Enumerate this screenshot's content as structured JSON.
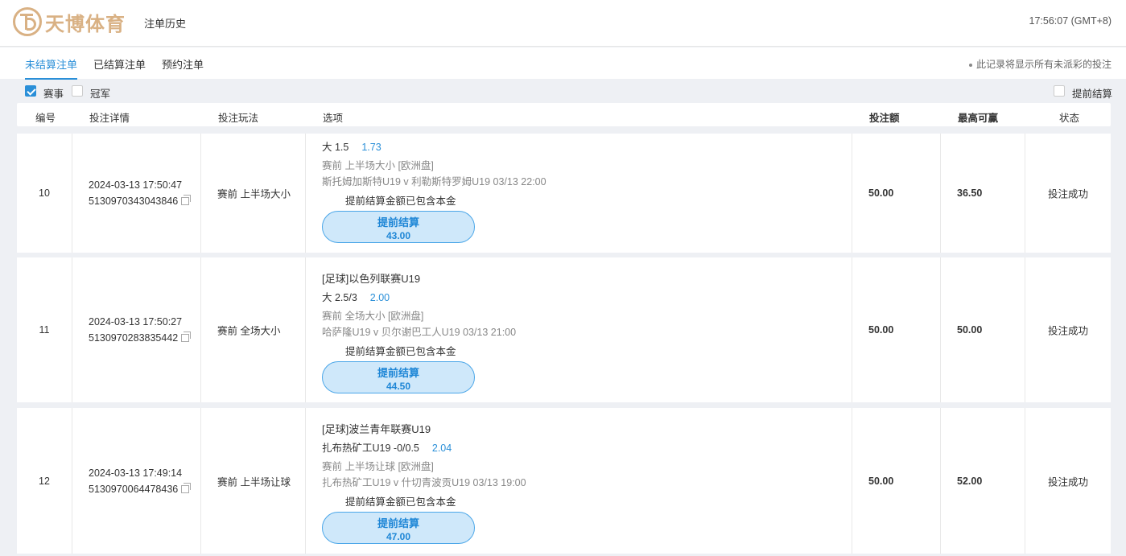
{
  "header": {
    "logo_text": "天博体育",
    "page_title": "注单历史",
    "clock": "17:56:07 (GMT+8)"
  },
  "tabs": [
    {
      "label": "未结算注单",
      "active": true
    },
    {
      "label": "已结算注单",
      "active": false
    },
    {
      "label": "预约注单",
      "active": false
    }
  ],
  "notice": "此记录将显示所有未派彩的投注",
  "filters": {
    "event_label": "赛事",
    "event_checked": true,
    "outright_label": "冠军",
    "outright_checked": false,
    "cashout_label": "提前结算",
    "cashout_checked": false
  },
  "columns": {
    "num": "编号",
    "detail": "投注详情",
    "play": "投注玩法",
    "option": "选项",
    "stake": "投注额",
    "maxwin": "最高可赢",
    "status": "状态"
  },
  "bets": [
    {
      "num": "10",
      "datetime": "2024-03-13 17:50:47",
      "bet_id": "5130970343043846",
      "play": "赛前 上半场大小",
      "league": "",
      "selection": "大 1.5",
      "odds": "1.73",
      "market": "赛前   上半场大小   [欧洲盘]",
      "match": "斯托姆加斯特U19 v 利勒斯特罗姆U19    03/13 22:00",
      "included_note": "提前结算金额已包含本金",
      "cashout_label": "提前结算",
      "cashout_amount": "43.00",
      "stake": "50.00",
      "maxwin": "36.50",
      "status": "投注成功"
    },
    {
      "num": "11",
      "datetime": "2024-03-13 17:50:27",
      "bet_id": "5130970283835442",
      "play": "赛前 全场大小",
      "league": "[足球]以色列联赛U19",
      "selection": "大 2.5/3",
      "odds": "2.00",
      "market": "赛前   全场大小   [欧洲盘]",
      "match": "哈萨隆U19 v 贝尔谢巴工人U19    03/13 21:00",
      "included_note": "提前结算金额已包含本金",
      "cashout_label": "提前结算",
      "cashout_amount": "44.50",
      "stake": "50.00",
      "maxwin": "50.00",
      "status": "投注成功"
    },
    {
      "num": "12",
      "datetime": "2024-03-13 17:49:14",
      "bet_id": "5130970064478436",
      "play": "赛前 上半场让球",
      "league": "[足球]波兰青年联赛U19",
      "selection": "扎布热矿工U19 -0/0.5",
      "odds": "2.04",
      "market": "赛前   上半场让球   [欧洲盘]",
      "match": "扎布热矿工U19 v 什切青波贡U19    03/13 19:00",
      "included_note": "提前结算金额已包含本金",
      "cashout_label": "提前结算",
      "cashout_amount": "47.00",
      "stake": "50.00",
      "maxwin": "52.00",
      "status": "投注成功"
    }
  ]
}
